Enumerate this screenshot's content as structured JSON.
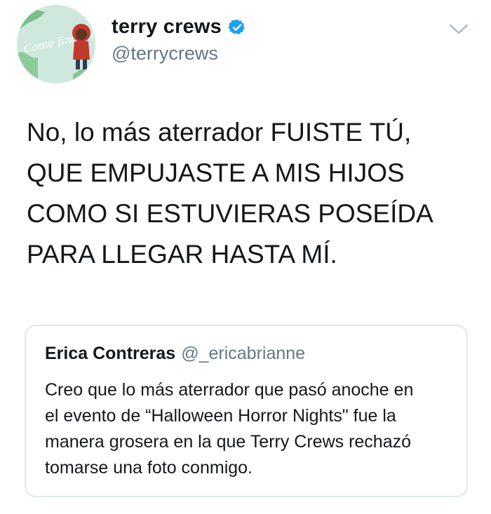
{
  "author": {
    "name": "terry crews",
    "handle": "@terrycrews",
    "verified": true,
    "avatar_icon": "avatar-image",
    "avatar_text": "Come find me"
  },
  "menu_icon": "chevron-down-icon",
  "tweet": {
    "lines": [
      "No, lo más aterrador FUISTE TÚ,",
      "QUE EMPUJASTE A MIS HIJOS",
      "COMO SI ESTUVIERAS POSEÍDA",
      "PARA LLEGAR HASTA MÍ."
    ]
  },
  "quoted_tweet": {
    "name": "Erica Contreras",
    "handle": "@_ericabrianne",
    "lines": [
      "Creo que lo más aterrador que pasó anoche en",
      "el evento de “Halloween Horror Nights\" fue la",
      "manera grosera en la que Terry Crews rechazó",
      "tomarse una foto conmigo."
    ]
  },
  "colors": {
    "text": "#14171a",
    "secondary": "#657786",
    "verified": "#1da1f2",
    "border": "#e1e8ed"
  }
}
